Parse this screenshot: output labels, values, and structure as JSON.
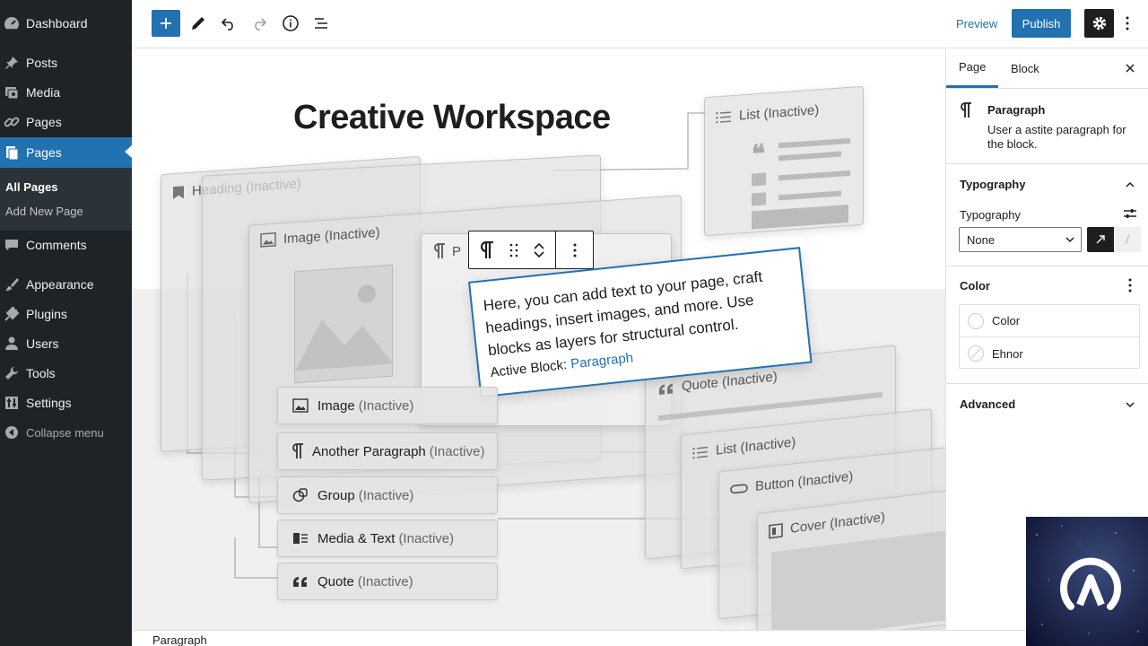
{
  "admin_menu": {
    "dashboard": "Dashboard",
    "posts": "Posts",
    "media": "Media",
    "pages": "Pages",
    "pages_active": "Pages",
    "submenu": {
      "all_pages": "All Pages",
      "add_new": "Add New Page"
    },
    "comments": "Comments",
    "appearance": "Appearance",
    "plugins": "Plugins",
    "users": "Users",
    "tools": "Tools",
    "settings": "Settings",
    "collapse": "Collapse menu"
  },
  "toolbar": {
    "preview": "Preview",
    "publish": "Publish"
  },
  "canvas": {
    "title": "Creative Workspace",
    "cards": {
      "heading": {
        "name": "Heading",
        "state": "(Inactive)"
      },
      "image_top": {
        "name": "Image",
        "state": "(Inactive)"
      },
      "list_top": {
        "name": "List",
        "state": "(Inactive)"
      },
      "para_stub": "P",
      "quote_right": {
        "name": "Quote",
        "state": "(Inactive)"
      },
      "list_right": {
        "name": "List",
        "state": "(Inactive)"
      },
      "button_right": {
        "name": "Button",
        "state": "(Inactive)"
      },
      "cover_right": {
        "name": "Cover",
        "state": "(Inactive)"
      }
    },
    "rows": [
      {
        "name": "Image",
        "state": "(Inactive)"
      },
      {
        "name": "Another Paragraph",
        "state": "(Inactive)"
      },
      {
        "name": "Group",
        "state": "(Inactive)"
      },
      {
        "name": "Media & Text",
        "state": "(Inactive)"
      },
      {
        "name": "Quote",
        "state": "(Inactive)"
      }
    ],
    "paragraph": {
      "text": "Here, you can add text to your page, craft headings, insert images, and more. Use blocks as layers for structural control.",
      "active_prefix": "Active Block:",
      "active_link": "Paragraph"
    }
  },
  "breadcrumb": "Paragraph",
  "sidebar": {
    "tabs": {
      "page": "Page",
      "block": "Block"
    },
    "block_name": "Paragraph",
    "block_desc": "User a astite paragraph for the block.",
    "typography_heading": "Typography",
    "typography_label": "Typography",
    "typography_value": "None",
    "color_heading": "Color",
    "colors": [
      "Color",
      "Ehnor"
    ],
    "advanced_heading": "Advanced"
  },
  "colors": {
    "accent": "#2271b1",
    "admin_bg": "#1d2327",
    "dark": "#1e1e1e"
  }
}
